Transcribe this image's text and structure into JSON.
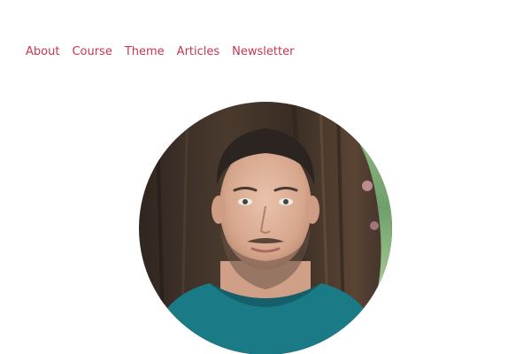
{
  "nav": {
    "items": [
      {
        "label": "About"
      },
      {
        "label": "Course"
      },
      {
        "label": "Theme"
      },
      {
        "label": "Articles"
      },
      {
        "label": "Newsletter"
      }
    ]
  },
  "colors": {
    "link": "#c2374f",
    "background": "#ffffff",
    "shirt": "#1a7a86"
  }
}
